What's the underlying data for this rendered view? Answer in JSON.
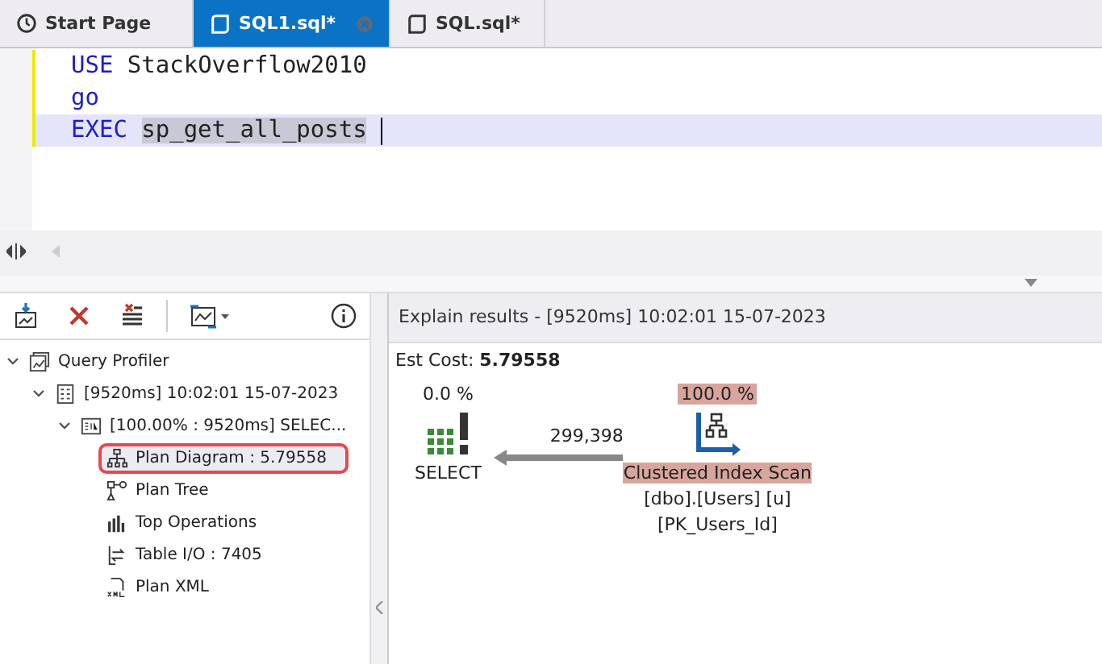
{
  "tabs": [
    {
      "label": "Start Page",
      "kind": "start",
      "selected": false
    },
    {
      "label": "SQL1.sql*",
      "kind": "sql",
      "selected": true
    },
    {
      "label": "SQL.sql*",
      "kind": "sql",
      "selected": false
    }
  ],
  "editor": {
    "lines": [
      {
        "current": false,
        "tokens": [
          {
            "text": "USE",
            "kind": "keyword"
          },
          {
            "text": "StackOverflow2010",
            "kind": "plain"
          }
        ]
      },
      {
        "current": false,
        "tokens": [
          {
            "text": "go",
            "kind": "keyword"
          }
        ]
      },
      {
        "current": true,
        "tokens": [
          {
            "text": "EXEC",
            "kind": "keyword"
          },
          {
            "text": "sp_get_all_posts",
            "kind": "selected"
          }
        ]
      }
    ]
  },
  "profiler": {
    "tree": [
      {
        "label": "Query Profiler",
        "kind": "profiler",
        "expanded": true,
        "selected": false,
        "children": [
          {
            "label": "[9520ms] 10:02:01 15-07-2023",
            "kind": "session",
            "expanded": true,
            "selected": false,
            "children": [
              {
                "label": "[100.00% : 9520ms] SELEC...",
                "kind": "sql",
                "expanded": true,
                "selected": false,
                "children": [
                  {
                    "label": "Plan Diagram : 5.79558",
                    "kind": "diagram",
                    "selected": true
                  },
                  {
                    "label": "Plan Tree",
                    "kind": "tree",
                    "selected": false
                  },
                  {
                    "label": "Top Operations",
                    "kind": "bars",
                    "selected": false
                  },
                  {
                    "label": "Table I/O : 7405",
                    "kind": "io",
                    "selected": false
                  },
                  {
                    "label": "Plan XML",
                    "kind": "xml",
                    "selected": false
                  }
                ]
              }
            ]
          }
        ]
      }
    ]
  },
  "results": {
    "title": "Explain results - [9520ms] 10:02:01 15-07-2023",
    "cost_label": "Est Cost:",
    "cost_value": "5.79558",
    "select_node": {
      "percent": "0.0 %",
      "label": "SELECT"
    },
    "arrow_rows": "299,398",
    "scan_node": {
      "percent": "100.0 %",
      "label": "Clustered Index Scan",
      "details": [
        "[dbo].[Users] [u]",
        "[PK_Users_Id]"
      ],
      "hot": true
    }
  }
}
